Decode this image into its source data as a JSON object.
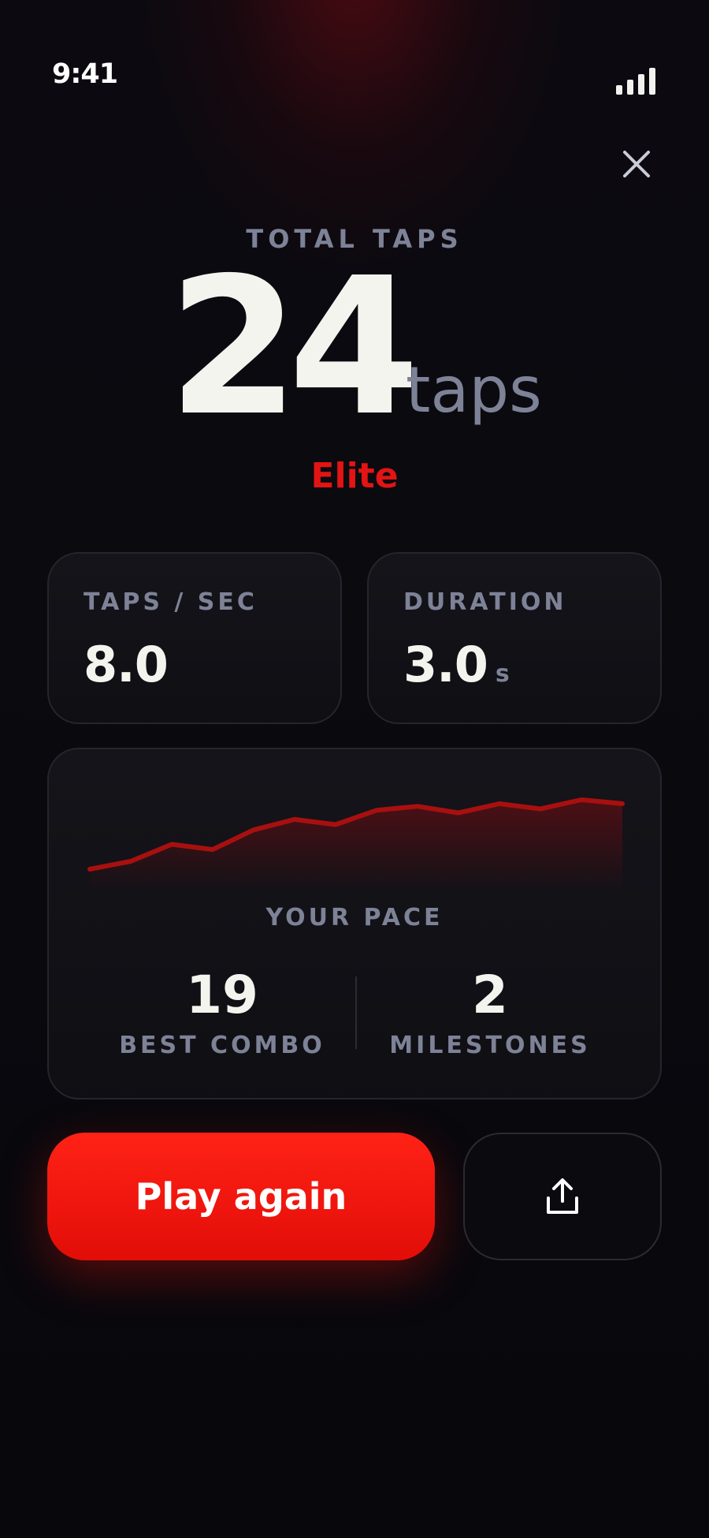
{
  "status": {
    "time": "9:41",
    "signal_icon": "signal-bars-icon"
  },
  "header": {
    "close_icon": "close-icon"
  },
  "result": {
    "kicker": "TOTAL TAPS",
    "count": "24",
    "unit": "taps",
    "tier": "Elite"
  },
  "stats": {
    "rate_label": "TAPS / SEC",
    "rate_value": "8.0",
    "duration_label": "DURATION",
    "duration_value": "3.0",
    "duration_unit": "s"
  },
  "pace": {
    "label": "YOUR PACE",
    "series": [
      0.0,
      0.12,
      0.38,
      0.3,
      0.6,
      0.76,
      0.68,
      0.9,
      0.96,
      0.86,
      1.0,
      0.92,
      1.06,
      1.0
    ],
    "best_combo_value": "19",
    "best_combo_label": "BEST COMBO",
    "milestones_value": "2",
    "milestones_label": "MILESTONES"
  },
  "actions": {
    "play_again_label": "Play again",
    "share_icon": "share-icon"
  },
  "colors": {
    "accent": "#e21414",
    "muted": "#7d8297",
    "background": "#0a0a10"
  }
}
